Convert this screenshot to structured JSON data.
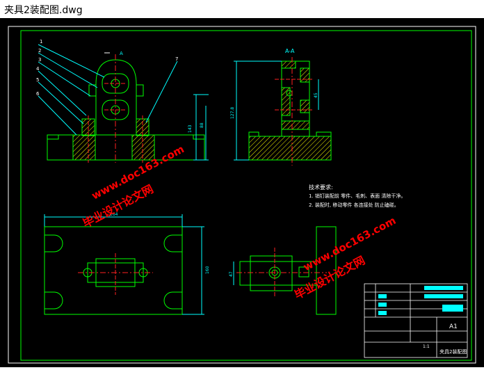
{
  "window": {
    "title": "夹具2装配图.dwg"
  },
  "colors": {
    "background": "#000000",
    "outline": "#00ff00",
    "leader": "#00ffff",
    "centerline": "#ff2020",
    "hatch": "#ffff00",
    "dimension": "#00ffff",
    "watermark": "#ff0000",
    "text": "#ffffff"
  },
  "drawing": {
    "section_label_top": "A",
    "section_view_label": "A-A",
    "part_callouts": [
      "1",
      "2",
      "3",
      "4",
      "5",
      "6",
      "7"
    ],
    "dimensions": {
      "front_height_a": "143",
      "front_height_b": "88",
      "side_height": "127.8",
      "side_small": "45",
      "plan_width": "264",
      "plan_height": "160",
      "right_small": "47"
    },
    "tech_requirements": {
      "heading": "技术要求:",
      "item1": "1. 销钉装配前 零件、毛刺、表面 清除干净。",
      "item2": "2. 装配时, 移动零件 各连接处 防止磕碰。"
    },
    "title_block": {
      "sheet_size": "A1",
      "drawing_name": "夹具2装配图",
      "ratio": "1:1"
    }
  },
  "watermarks": [
    {
      "cn": "毕业设计论文网",
      "url": "www.doc163.com"
    },
    {
      "cn": "毕业设计论文网",
      "url": "www.doc163.com"
    }
  ]
}
